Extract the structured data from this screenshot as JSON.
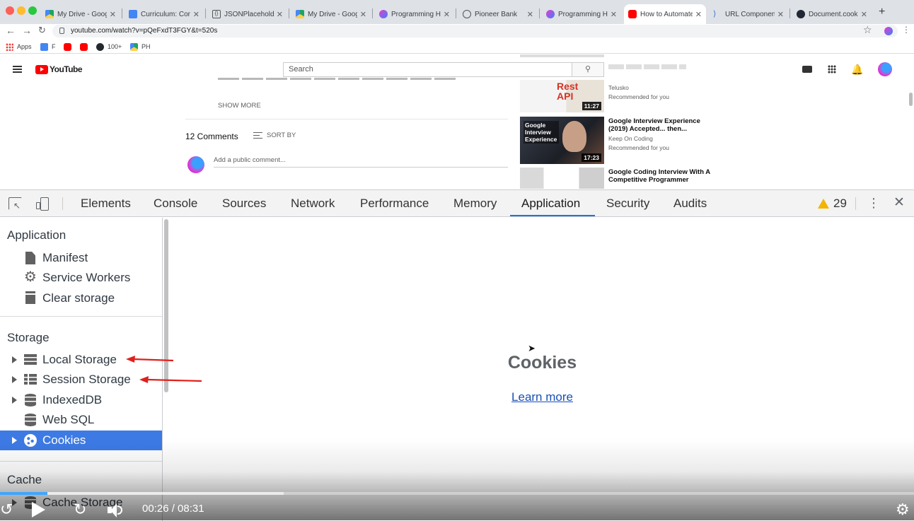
{
  "browser": {
    "tabs": [
      {
        "title": "My Drive - Google",
        "favicon": "drive",
        "active": false
      },
      {
        "title": "Curriculum: Comp",
        "favicon": "docs",
        "active": false
      },
      {
        "title": "JSONPlaceholder",
        "favicon": "code",
        "active": false
      },
      {
        "title": "My Drive - Google",
        "favicon": "drive",
        "active": false
      },
      {
        "title": "Programming Hero",
        "favicon": "hero",
        "active": false
      },
      {
        "title": "Pioneer Bank",
        "favicon": "globe",
        "active": false
      },
      {
        "title": "Programming Hero",
        "favicon": "hero",
        "active": false
      },
      {
        "title": "How to Automate",
        "favicon": "youtube",
        "active": true
      },
      {
        "title": "URL Components",
        "favicon": "url",
        "active": false
      },
      {
        "title": "Document.cookie",
        "favicon": "mdn",
        "active": false
      }
    ],
    "new_tab": "+",
    "url": "youtube.com/watch?v=pQeFxdT3FGY&t=520s",
    "bookmarks": [
      {
        "label": "Apps",
        "icon": "apps-grid"
      },
      {
        "label": "F",
        "icon": "docs"
      },
      {
        "label": "",
        "icon": "youtube"
      },
      {
        "label": "",
        "icon": "youtube"
      },
      {
        "label": "100+",
        "icon": "github"
      },
      {
        "label": "PH",
        "icon": "drive"
      }
    ]
  },
  "youtube": {
    "logo_text": "YouTube",
    "search_placeholder": "Search",
    "show_more": "SHOW MORE",
    "comments_count": "12 Comments",
    "sort_by": "SORT BY",
    "add_comment": "Add a public comment...",
    "recommendations": [
      {
        "title": "",
        "channel": "Telusko",
        "meta": "Recommended for you",
        "duration": "11:27",
        "thumb_text": "Rest API"
      },
      {
        "title": "Google Interview Experience (2019) Accepted... then...",
        "channel": "Keep On Coding",
        "meta": "Recommended for you",
        "duration": "17:23",
        "thumb_text": "Google Interview Experience"
      },
      {
        "title": "Google Coding Interview With A Competitive Programmer",
        "channel": "",
        "meta": "",
        "duration": "",
        "thumb_text": ""
      }
    ]
  },
  "devtools": {
    "tabs": [
      "Elements",
      "Console",
      "Sources",
      "Network",
      "Performance",
      "Memory",
      "Application",
      "Security",
      "Audits"
    ],
    "active_tab": "Application",
    "warnings_count": "29",
    "sidebar": {
      "application_title": "Application",
      "application_items": [
        {
          "label": "Manifest",
          "icon": "file-icon"
        },
        {
          "label": "Service Workers",
          "icon": "gear-icon"
        },
        {
          "label": "Clear storage",
          "icon": "trash-icon"
        }
      ],
      "storage_title": "Storage",
      "storage_items": [
        {
          "label": "Local Storage",
          "icon": "grid-icon",
          "expandable": true
        },
        {
          "label": "Session Storage",
          "icon": "grid-icon",
          "expandable": true
        },
        {
          "label": "IndexedDB",
          "icon": "database-icon",
          "expandable": true
        },
        {
          "label": "Web SQL",
          "icon": "database-icon",
          "expandable": false
        },
        {
          "label": "Cookies",
          "icon": "cookie-icon",
          "expandable": true,
          "selected": true
        }
      ],
      "cache_title": "Cache",
      "cache_items": [
        {
          "label": "Cache Storage",
          "icon": "database-icon"
        }
      ]
    },
    "main": {
      "heading": "Cookies",
      "link": "Learn more"
    }
  },
  "video": {
    "time": "00:26 / 08:31",
    "progress": 0.052,
    "buffered": 0.31
  },
  "colors": {
    "selected_row": "#3d7ae4",
    "active_tab_underline": "#1a73e8",
    "annotation_arrow": "#e0201b",
    "youtube_red": "#ff0000",
    "progress": "#3ea6ff"
  }
}
